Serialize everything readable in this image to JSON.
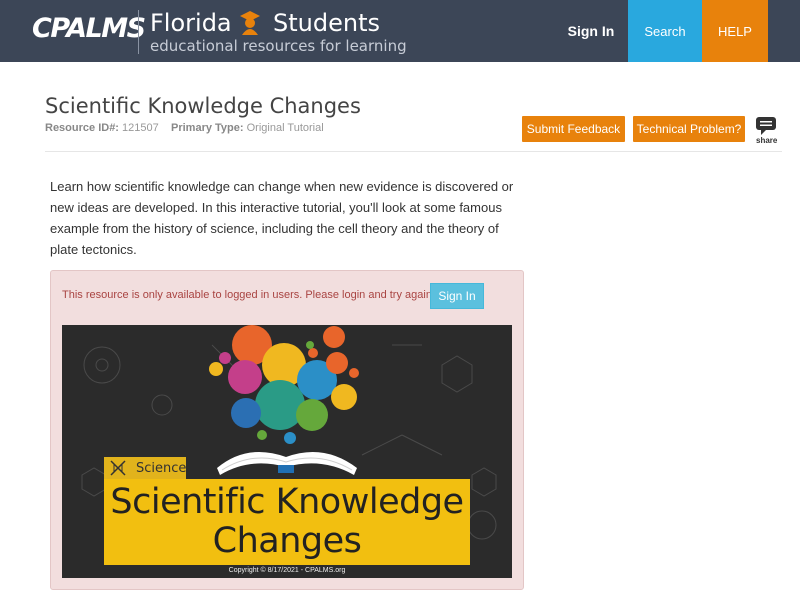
{
  "header": {
    "logo_text": "CPALMS",
    "brand_state": "Florida",
    "brand_audience": "Students",
    "brand_subtitle": "educational resources for learning",
    "nav": {
      "signin_label": "Sign In",
      "search_label": "Search",
      "help_label": "HELP"
    },
    "colors": {
      "bar": "#3c4657",
      "search": "#29a8de",
      "help": "#e8820c"
    }
  },
  "resource": {
    "title": "Scientific Knowledge Changes",
    "id_label": "Resource ID#:",
    "id_value": "121507",
    "type_label": "Primary Type:",
    "type_value": "Original Tutorial",
    "submit_feedback_label": "Submit Feedback",
    "technical_problem_label": "Technical Problem?",
    "share_label": "share",
    "description": "Learn how scientific knowledge can change when new evidence is discovered or new ideas are developed. In this interactive tutorial, you'll look at some famous example from the history of science, including the cell theory and the theory of plate tectonics."
  },
  "login_panel": {
    "message": "This resource is only available to logged in users. Please login and try again.",
    "signin_label": "Sign In"
  },
  "banner": {
    "tag": "Science",
    "title_line1": "Scientific Knowledge",
    "title_line2": "Changes",
    "copyright": "Copyright © 8/17/2021 - CPALMS.org"
  }
}
